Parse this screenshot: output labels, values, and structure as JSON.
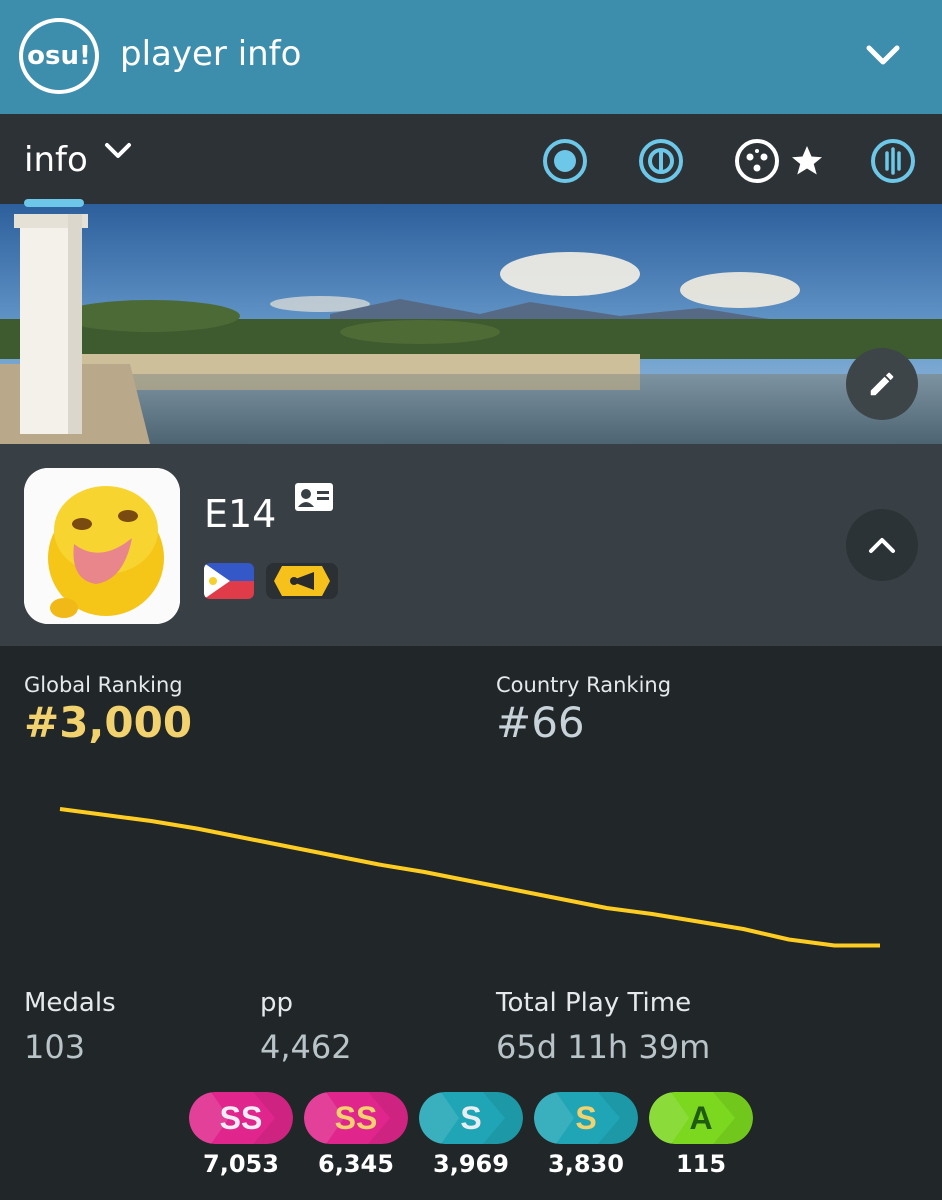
{
  "header": {
    "logo_text": "osu!",
    "title": "player info",
    "collapse_icon": "chevron-down-icon"
  },
  "tabbar": {
    "current_tab": "info",
    "modes": [
      {
        "name": "osu-standard-mode-icon"
      },
      {
        "name": "osu-taiko-mode-icon"
      },
      {
        "name": "osu-catch-mode-icon",
        "default_star": true
      },
      {
        "name": "osu-mania-mode-icon"
      }
    ]
  },
  "profile": {
    "username": "E14",
    "country": "Philippines",
    "team_icon": "team-flag-icon"
  },
  "stats": {
    "global_label": "Global Ranking",
    "global_value": "#3,000",
    "country_label": "Country Ranking",
    "country_value": "#66",
    "medals_label": "Medals",
    "medals_value": "103",
    "pp_label": "pp",
    "pp_value": "4,462",
    "playtime_label": "Total Play Time",
    "playtime_value": "65d 11h 39m"
  },
  "chart_data": {
    "type": "line",
    "series": [
      {
        "values": [
          0.06,
          0.1,
          0.14,
          0.19,
          0.25,
          0.31,
          0.37,
          0.43,
          0.48,
          0.54,
          0.6,
          0.66,
          0.72,
          0.76,
          0.81,
          0.86,
          0.93,
          0.97,
          0.97
        ]
      }
    ],
    "color": "#ffcc22",
    "note_values": ""
  },
  "grades": [
    {
      "label": "SS",
      "count": "7,053",
      "bg": "#e0268d",
      "text": "#f0eef5"
    },
    {
      "label": "SS",
      "count": "6,345",
      "bg": "#e0268d",
      "text": "#f2d26e"
    },
    {
      "label": "S",
      "count": "3,969",
      "bg": "#1fa5b5",
      "text": "#e8eef2"
    },
    {
      "label": "S",
      "count": "3,830",
      "bg": "#1fa5b5",
      "text": "#f2d26e"
    },
    {
      "label": "A",
      "count": "115",
      "bg": "#7cd81f",
      "text": "#1f5c12"
    }
  ]
}
